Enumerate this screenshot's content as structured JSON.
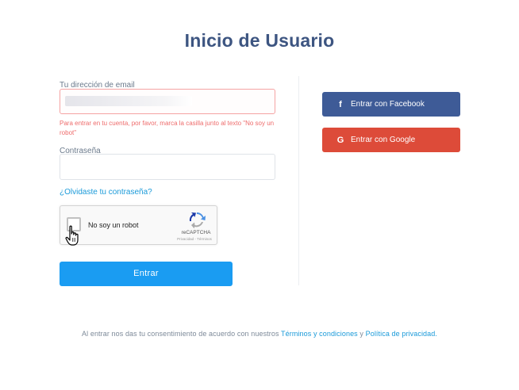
{
  "page": {
    "title": "Inicio de Usuario"
  },
  "form": {
    "email_label": "Tu dirección de email",
    "email_error": "Para entrar en tu cuenta, por favor, marca la casilla junto al texto \"No soy un robot\"",
    "password_label": "Contraseña",
    "forgot_link": "¿Olvidaste tu contraseña?",
    "submit_label": "Entrar"
  },
  "recaptcha": {
    "label": "No soy un robot",
    "brand": "reCAPTCHA",
    "terms": "Privacidad - Términos"
  },
  "social": {
    "facebook_label": "Entrar con Facebook",
    "google_label": "Entrar con Google",
    "facebook_icon": "facebook-icon",
    "google_icon": "google-icon"
  },
  "footer": {
    "prefix": "Al entrar nos das tu consentimiento de acuerdo con nuestros",
    "terms_link": "Términos y condiciones",
    "and": "y",
    "privacy_link": "Política de privacidad",
    "suffix": "."
  },
  "colors": {
    "title": "#3d5581",
    "primary": "#1a9cf2",
    "facebook": "#3e5b97",
    "google": "#dd4b39",
    "error": "#ee6b6b",
    "link": "#1a9ad9"
  }
}
